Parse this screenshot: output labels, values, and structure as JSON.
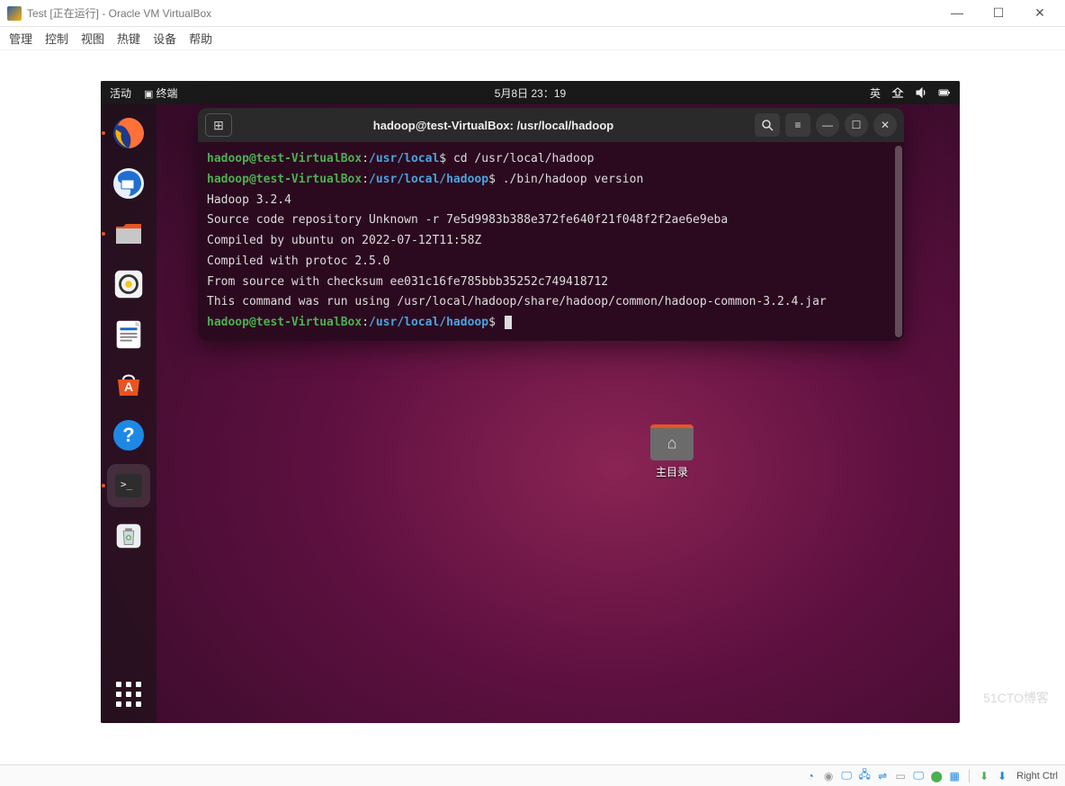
{
  "virtualbox": {
    "title": "Test [正在运行] - Oracle VM VirtualBox",
    "menu": [
      "管理",
      "控制",
      "视图",
      "热键",
      "设备",
      "帮助"
    ],
    "host_key": "Right Ctrl",
    "win_min": "—",
    "win_max": "☐",
    "win_close": "✕"
  },
  "ubuntu_topbar": {
    "activities": "活动",
    "app_label": "终端",
    "datetime": "5月8日  23：19",
    "ime": "英"
  },
  "dock": [
    {
      "name": "firefox",
      "color": "#ff7139"
    },
    {
      "name": "thunderbird",
      "color": "#1f6fd0"
    },
    {
      "name": "files",
      "color": "#e95420"
    },
    {
      "name": "rhythmbox",
      "color": "#f5c518"
    },
    {
      "name": "libreoffice-writer",
      "color": "#1565c0"
    },
    {
      "name": "software",
      "color": "#e95420"
    },
    {
      "name": "help",
      "color": "#1e88e5"
    },
    {
      "name": "terminal",
      "color": "#2d2d2d"
    },
    {
      "name": "trash",
      "color": "#cfd8dc"
    }
  ],
  "desktop": {
    "home_folder_label": "主目录"
  },
  "terminal": {
    "title": "hadoop@test-VirtualBox: /usr/local/hadoop",
    "lines": [
      {
        "user": "hadoop@test-VirtualBox",
        "path": "/usr/local",
        "cmd": "cd /usr/local/hadoop"
      },
      {
        "user": "hadoop@test-VirtualBox",
        "path": "/usr/local/hadoop",
        "cmd": "./bin/hadoop version"
      },
      {
        "out": "Hadoop 3.2.4"
      },
      {
        "out": "Source code repository Unknown -r 7e5d9983b388e372fe640f21f048f2f2ae6e9eba"
      },
      {
        "out": "Compiled by ubuntu on 2022-07-12T11:58Z"
      },
      {
        "out": "Compiled with protoc 2.5.0"
      },
      {
        "out": "From source with checksum ee031c16fe785bbb35252c749418712"
      },
      {
        "out": "This command was run using /usr/local/hadoop/share/hadoop/common/hadoop-common-3.2.4.jar"
      },
      {
        "user": "hadoop@test-VirtualBox",
        "path": "/usr/local/hadoop",
        "cmd": "",
        "cursor": true
      }
    ]
  },
  "watermark": "51CTO博客"
}
